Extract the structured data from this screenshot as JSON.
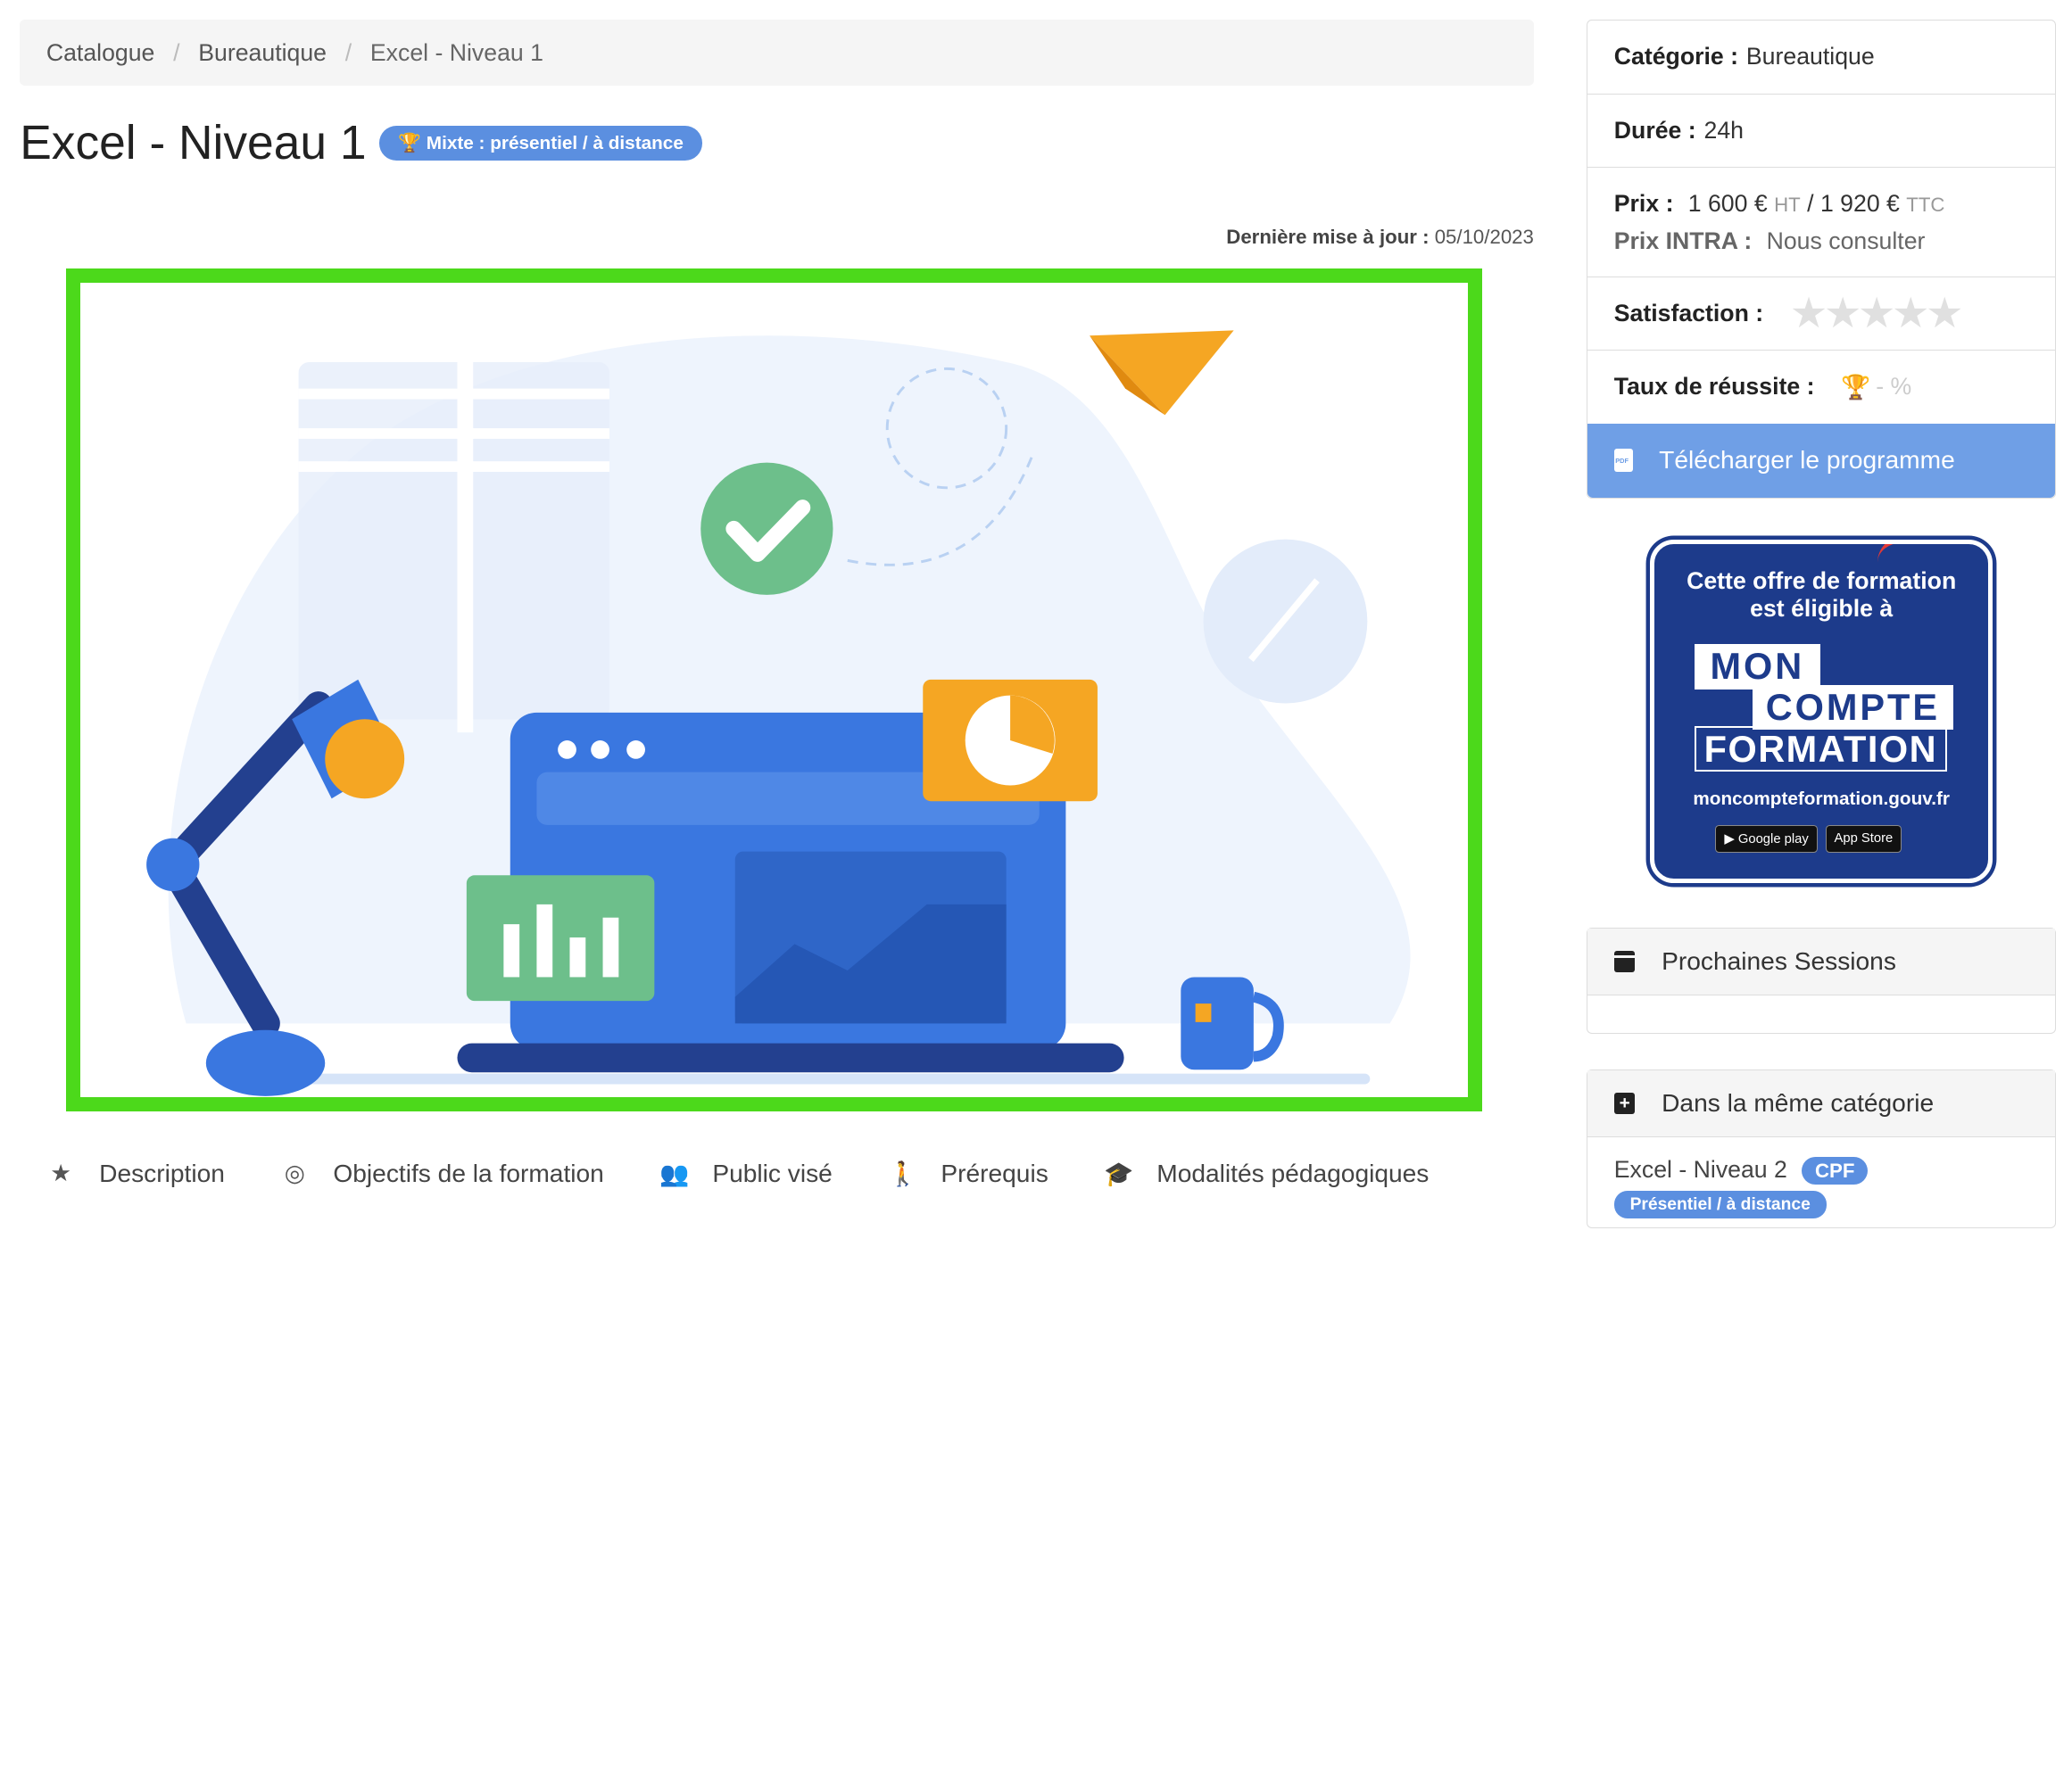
{
  "breadcrumb": {
    "items": [
      "Catalogue",
      "Bureautique"
    ],
    "current": "Excel - Niveau 1"
  },
  "title": "Excel - Niveau 1",
  "mode_badge": "Mixte : présentiel / à distance",
  "updated": {
    "label": "Dernière mise à jour :",
    "value": "05/10/2023"
  },
  "tabs": [
    {
      "icon": "star-icon",
      "label": "Description"
    },
    {
      "icon": "target-icon",
      "label": "Objectifs de la formation"
    },
    {
      "icon": "users-icon",
      "label": "Public visé"
    },
    {
      "icon": "walk-icon",
      "label": "Prérequis"
    },
    {
      "icon": "graduation-cap-icon",
      "label": "Modalités pédagogiques"
    }
  ],
  "info": {
    "category_label": "Catégorie :",
    "category": "Bureautique",
    "duration_label": "Durée :",
    "duration": "24h",
    "price_label": "Prix :",
    "price_ht": "1 600 €",
    "ht": "HT",
    "slash": "/",
    "price_ttc": "1 920 €",
    "ttc": "TTC",
    "intra_label": "Prix INTRA :",
    "intra": "Nous consulter",
    "satisfaction_label": "Satisfaction :",
    "satisfaction_stars": "★★★★★",
    "success_label": "Taux de réussite :",
    "success_value": "- %",
    "download": "Télécharger le programme"
  },
  "cpf": {
    "line1": "Cette offre de formation",
    "line2": "est éligible à",
    "mon": "MON",
    "compte": "COMPTE",
    "formation": "FORMATION",
    "url": "moncompteformation.gouv.fr",
    "store1": "Google play",
    "store2": "App Store"
  },
  "sessions": {
    "title": "Prochaines Sessions"
  },
  "same_category": {
    "title": "Dans la même catégorie",
    "item": "Excel - Niveau 2",
    "badge": "CPF",
    "mode": "Présentiel / à distance"
  },
  "colors": {
    "accent": "#5b8fe0",
    "hero_border": "#4cd91b",
    "cpf_blue": "#1d3b8b",
    "cpf_red": "#e53935"
  }
}
